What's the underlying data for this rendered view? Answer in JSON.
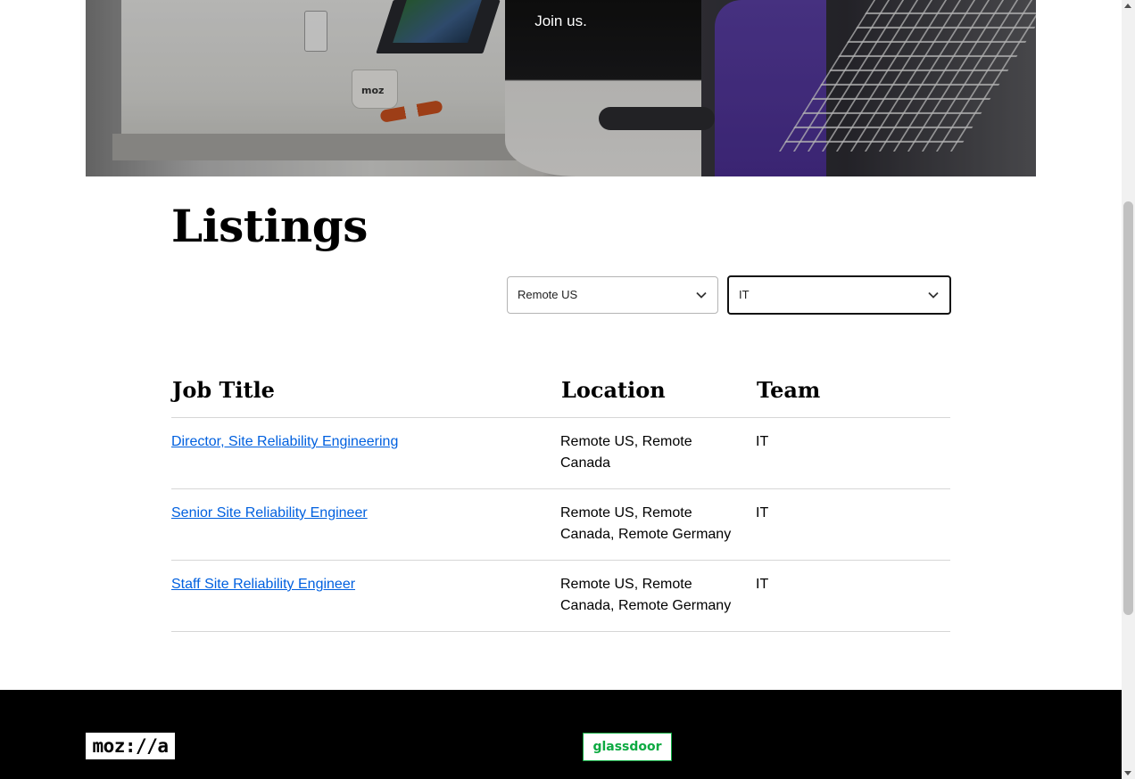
{
  "hero": {
    "tagline": "Join us.",
    "mug_text": "moz"
  },
  "listings": {
    "title": "Listings",
    "filters": {
      "location": {
        "selected": "Remote US"
      },
      "team": {
        "selected": "IT"
      }
    },
    "table": {
      "headers": [
        "Job Title",
        "Location",
        "Team"
      ],
      "rows": [
        {
          "title": "Director, Site Reliability Engineering",
          "location": "Remote US, Remote Canada",
          "team": "IT"
        },
        {
          "title": "Senior Site Reliability Engineer",
          "location": "Remote US, Remote Canada, Remote Germany",
          "team": "IT"
        },
        {
          "title": "Staff Site Reliability Engineer",
          "location": "Remote US, Remote Canada, Remote Germany",
          "team": "IT"
        }
      ]
    }
  },
  "footer": {
    "mozilla_logo_text": "moz://a",
    "glassdoor_logo_text": "glassdoor"
  },
  "colors": {
    "link": "#0060df",
    "footer_bg": "#000000",
    "glassdoor_green": "#0caa41"
  }
}
